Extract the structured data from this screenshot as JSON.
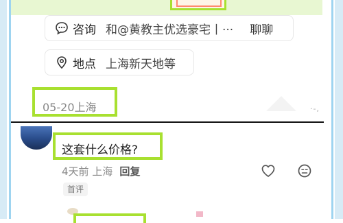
{
  "consult": {
    "title": "咨询",
    "value": "和@黄教主优选豪宅丨···",
    "action": "聊聊"
  },
  "location": {
    "title": "地点",
    "value": "上海新天地等"
  },
  "post_meta": {
    "date_place": "05-20上海",
    "right_truncated": "·-,"
  },
  "comment": {
    "text": "这套什么价格?",
    "time_place": "4天前 上海",
    "reply_label": "回复",
    "badge": "首评"
  },
  "colors": {
    "highlight_green": "#a8e030",
    "frame_blue": "#9ed4f0"
  }
}
